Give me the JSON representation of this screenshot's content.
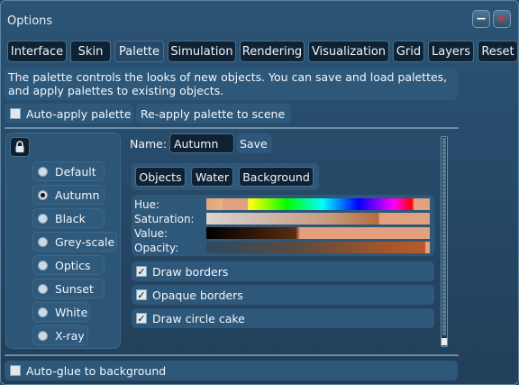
{
  "window": {
    "title": "Options",
    "minimize_label": "−",
    "close_label": "×"
  },
  "tabs": [
    "Interface",
    "Skin",
    "Palette",
    "Simulation",
    "Rendering",
    "Visualization",
    "Grid",
    "Layers",
    "Reset"
  ],
  "active_tab": "Palette",
  "description": {
    "line1": "The palette controls the looks of new objects. You can save and load palettes,",
    "line2": "and apply palettes to existing objects."
  },
  "auto_apply": {
    "label": "Auto-apply palette",
    "checked": false
  },
  "reapply_label": "Re-apply palette to scene",
  "palettes": [
    {
      "label": "Default",
      "selected": false
    },
    {
      "label": "Autumn",
      "selected": true
    },
    {
      "label": "Black",
      "selected": false
    },
    {
      "label": "Grey-scale",
      "selected": false
    },
    {
      "label": "Optics",
      "selected": false
    },
    {
      "label": "Sunset",
      "selected": false
    },
    {
      "label": "White",
      "selected": false
    },
    {
      "label": "X-ray",
      "selected": false
    }
  ],
  "name_field": {
    "label": "Name:",
    "value": "Autumn"
  },
  "save_label": "Save",
  "subtabs": [
    "Objects",
    "Water",
    "Background"
  ],
  "active_subtab": "Objects",
  "sliders": {
    "hue_label": "Hue:",
    "saturation_label": "Saturation:",
    "value_label": "Value:",
    "opacity_label": "Opacity:"
  },
  "options": [
    {
      "label": "Draw borders",
      "checked": true
    },
    {
      "label": "Opaque borders",
      "checked": true
    },
    {
      "label": "Draw circle cake",
      "checked": true
    }
  ],
  "auto_glue": {
    "label": "Auto-glue to background",
    "checked": false
  },
  "colors": {
    "accent_dark": "#0f2233",
    "panel": "#2e587a",
    "swatch_base": "#e3a07e"
  }
}
